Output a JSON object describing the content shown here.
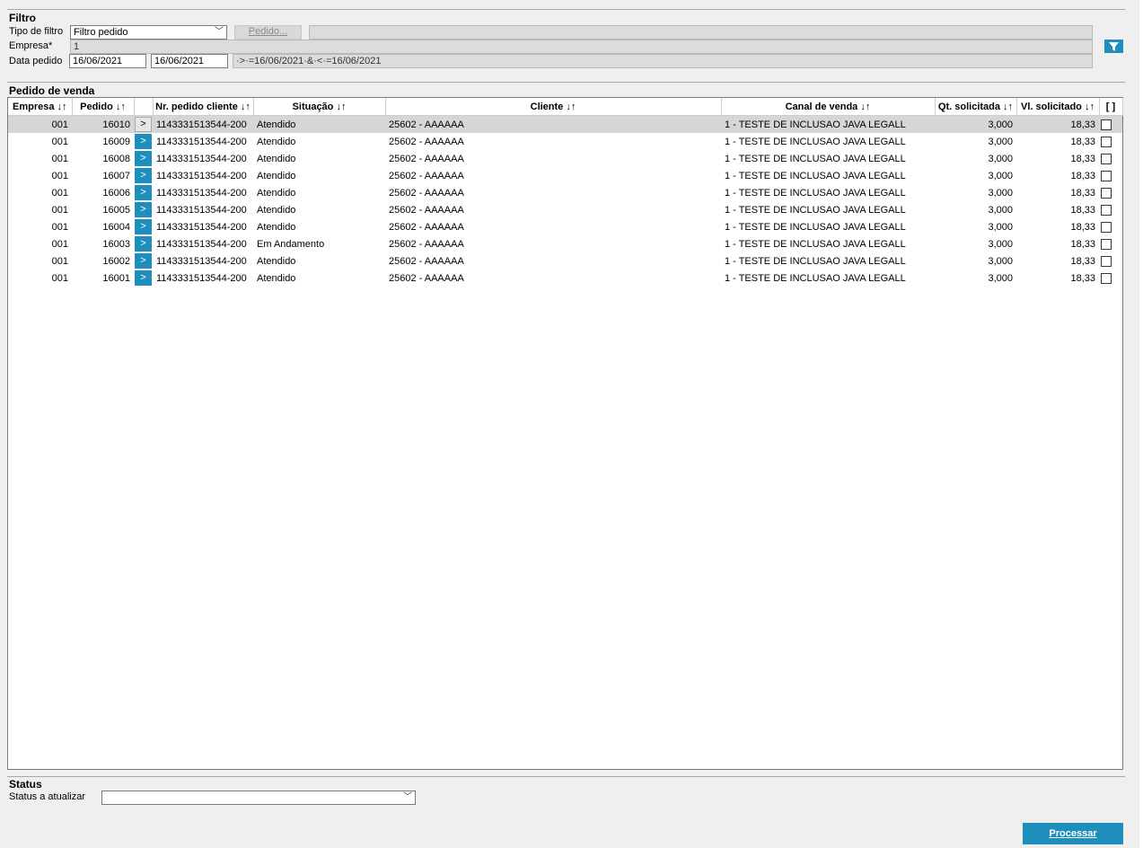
{
  "filtro": {
    "title": "Filtro",
    "tipo_label": "Tipo de filtro",
    "tipo_value": "Filtro pedido",
    "pedido_button": "Pedido...",
    "empresa_label": "Empresa*",
    "empresa_value": "1",
    "data_label": "Data pedido",
    "data_from": "16/06/2021",
    "data_to": "16/06/2021",
    "data_expr": "·>·=16/06/2021·&·<·=16/06/2021"
  },
  "grid": {
    "title": "Pedido de venda",
    "headers": {
      "empresa": "Empresa ↓↑",
      "pedido": "Pedido ↓↑",
      "nr_pedido": "Nr. pedido cliente ↓↑",
      "situacao": "Situação ↓↑",
      "cliente": "Cliente ↓↑",
      "canal": "Canal de venda ↓↑",
      "qt": "Qt. solicitada ↓↑",
      "vl": "Vl. solicitado ↓↑",
      "sel": "[ ]"
    },
    "go_label": ">",
    "rows": [
      {
        "empresa": "001",
        "pedido": "16010",
        "nr": "1143331513544-200",
        "situacao": "Atendido",
        "cliente": "25602 - AAAAAA",
        "canal": "1 - TESTE DE INCLUSAO JAVA LEGALL",
        "qt": "3,000",
        "vl": "18,33"
      },
      {
        "empresa": "001",
        "pedido": "16009",
        "nr": "1143331513544-200",
        "situacao": "Atendido",
        "cliente": "25602 - AAAAAA",
        "canal": "1 - TESTE DE INCLUSAO JAVA LEGALL",
        "qt": "3,000",
        "vl": "18,33"
      },
      {
        "empresa": "001",
        "pedido": "16008",
        "nr": "1143331513544-200",
        "situacao": "Atendido",
        "cliente": "25602 - AAAAAA",
        "canal": "1 - TESTE DE INCLUSAO JAVA LEGALL",
        "qt": "3,000",
        "vl": "18,33"
      },
      {
        "empresa": "001",
        "pedido": "16007",
        "nr": "1143331513544-200",
        "situacao": "Atendido",
        "cliente": "25602 - AAAAAA",
        "canal": "1 - TESTE DE INCLUSAO JAVA LEGALL",
        "qt": "3,000",
        "vl": "18,33"
      },
      {
        "empresa": "001",
        "pedido": "16006",
        "nr": "1143331513544-200",
        "situacao": "Atendido",
        "cliente": "25602 - AAAAAA",
        "canal": "1 - TESTE DE INCLUSAO JAVA LEGALL",
        "qt": "3,000",
        "vl": "18,33"
      },
      {
        "empresa": "001",
        "pedido": "16005",
        "nr": "1143331513544-200",
        "situacao": "Atendido",
        "cliente": "25602 - AAAAAA",
        "canal": "1 - TESTE DE INCLUSAO JAVA LEGALL",
        "qt": "3,000",
        "vl": "18,33"
      },
      {
        "empresa": "001",
        "pedido": "16004",
        "nr": "1143331513544-200",
        "situacao": "Atendido",
        "cliente": "25602 - AAAAAA",
        "canal": "1 - TESTE DE INCLUSAO JAVA LEGALL",
        "qt": "3,000",
        "vl": "18,33"
      },
      {
        "empresa": "001",
        "pedido": "16003",
        "nr": "1143331513544-200",
        "situacao": "Em Andamento",
        "cliente": "25602 - AAAAAA",
        "canal": "1 - TESTE DE INCLUSAO JAVA LEGALL",
        "qt": "3,000",
        "vl": "18,33"
      },
      {
        "empresa": "001",
        "pedido": "16002",
        "nr": "1143331513544-200",
        "situacao": "Atendido",
        "cliente": "25602 - AAAAAA",
        "canal": "1 - TESTE DE INCLUSAO JAVA LEGALL",
        "qt": "3,000",
        "vl": "18,33"
      },
      {
        "empresa": "001",
        "pedido": "16001",
        "nr": "1143331513544-200",
        "situacao": "Atendido",
        "cliente": "25602 - AAAAAA",
        "canal": "1 - TESTE DE INCLUSAO JAVA LEGALL",
        "qt": "3,000",
        "vl": "18,33"
      }
    ]
  },
  "status": {
    "title": "Status",
    "label": "Status a atualizar",
    "value": ""
  },
  "process_button": "Processar",
  "colors": {
    "accent": "#1e8fbd",
    "selected_row": "#d6d6d6"
  }
}
